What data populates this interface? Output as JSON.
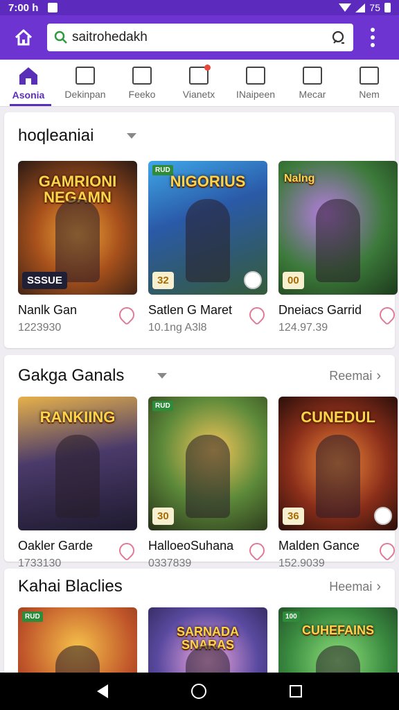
{
  "status_bar": {
    "time": "7:00 h",
    "right_text": "75"
  },
  "app_bar": {
    "search_value": "saitrohedakh"
  },
  "tabs": [
    {
      "label": "Asonia",
      "icon": "home-icon",
      "active": true
    },
    {
      "label": "Dekinpan",
      "icon": "edit-icon"
    },
    {
      "label": "Feeko",
      "icon": "chat-icon"
    },
    {
      "label": "Vianetx",
      "icon": "notification-icon"
    },
    {
      "label": "INaipeen",
      "icon": "dashboard-icon"
    },
    {
      "label": "Mecar",
      "icon": "image-icon"
    },
    {
      "label": "Nem",
      "icon": "crop-icon"
    }
  ],
  "sections": [
    {
      "title": "hoqleaniai",
      "link": "",
      "cards": [
        {
          "name": "Nanlk Gan",
          "sub": "1223930",
          "art": "GAMRIONI NEGAMN",
          "badge": "SSSUE"
        },
        {
          "name": "Satlen G Maret",
          "sub": "10.1ng A3l8",
          "art": "NIGORIUS",
          "badge": "32",
          "badge_tl": "RUD"
        },
        {
          "name": "Dneiacs Garrid",
          "sub": "124.97.39",
          "art": "Nalng",
          "badge": "00"
        }
      ]
    },
    {
      "title": "Gakga Ganals",
      "link": "Reemai",
      "cards": [
        {
          "name": "Oakler Garde",
          "sub": "1733130",
          "art": "RANKIING",
          "badge": ""
        },
        {
          "name": "HalloeoSuhana",
          "sub": "0337839",
          "art": "",
          "badge": "30",
          "badge_tl": "RUD"
        },
        {
          "name": "Malden Gance",
          "sub": "152.9039",
          "art": "CUNEDUL",
          "badge": "36"
        }
      ]
    },
    {
      "title": "Kahai Blaclies",
      "link": "Heemai",
      "cards": [
        {
          "name": "",
          "sub": "",
          "art": "",
          "badge_tl": "RUD"
        },
        {
          "name": "",
          "sub": "",
          "art": "SARNADA SNARAS"
        },
        {
          "name": "",
          "sub": "",
          "art": "CUHEFAINS",
          "badge_tl": "100"
        }
      ]
    }
  ]
}
